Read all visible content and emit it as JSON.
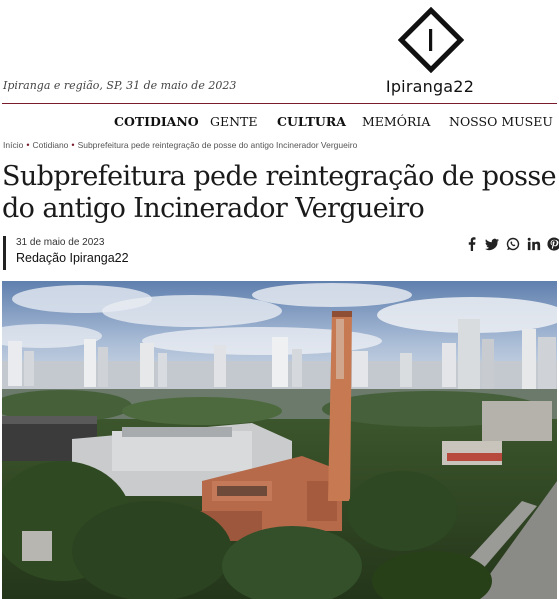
{
  "header": {
    "dateline": "Ipiranga e região, SP, 31 de maio de 2023",
    "logo_text": "Ipiranga22",
    "logo_mark": "I",
    "accent_color": "#7a1c2b"
  },
  "nav": {
    "items": [
      {
        "label": "COTIDIANO",
        "bold": true
      },
      {
        "label": "GENTE",
        "bold": false
      },
      {
        "label": "CULTURA",
        "bold": true
      },
      {
        "label": "MEMÓRIA",
        "bold": false
      },
      {
        "label": "NOSSO MUSEU",
        "bold": false
      }
    ]
  },
  "breadcrumb": {
    "items": [
      "Início",
      "Cotidiano",
      "Subprefeitura pede reintegração de posse do antigo Incinerador Vergueiro"
    ]
  },
  "article": {
    "title": "Subprefeitura pede reintegração de posse do antigo Incinerador Vergueiro",
    "date": "31 de maio de 2023",
    "author": "Redação Ipiranga22"
  },
  "share": {
    "icons": [
      "facebook-icon",
      "twitter-icon",
      "whatsapp-icon",
      "linkedin-icon",
      "pinterest-icon"
    ]
  },
  "photo": {
    "subject": "aerial-city-photo"
  }
}
